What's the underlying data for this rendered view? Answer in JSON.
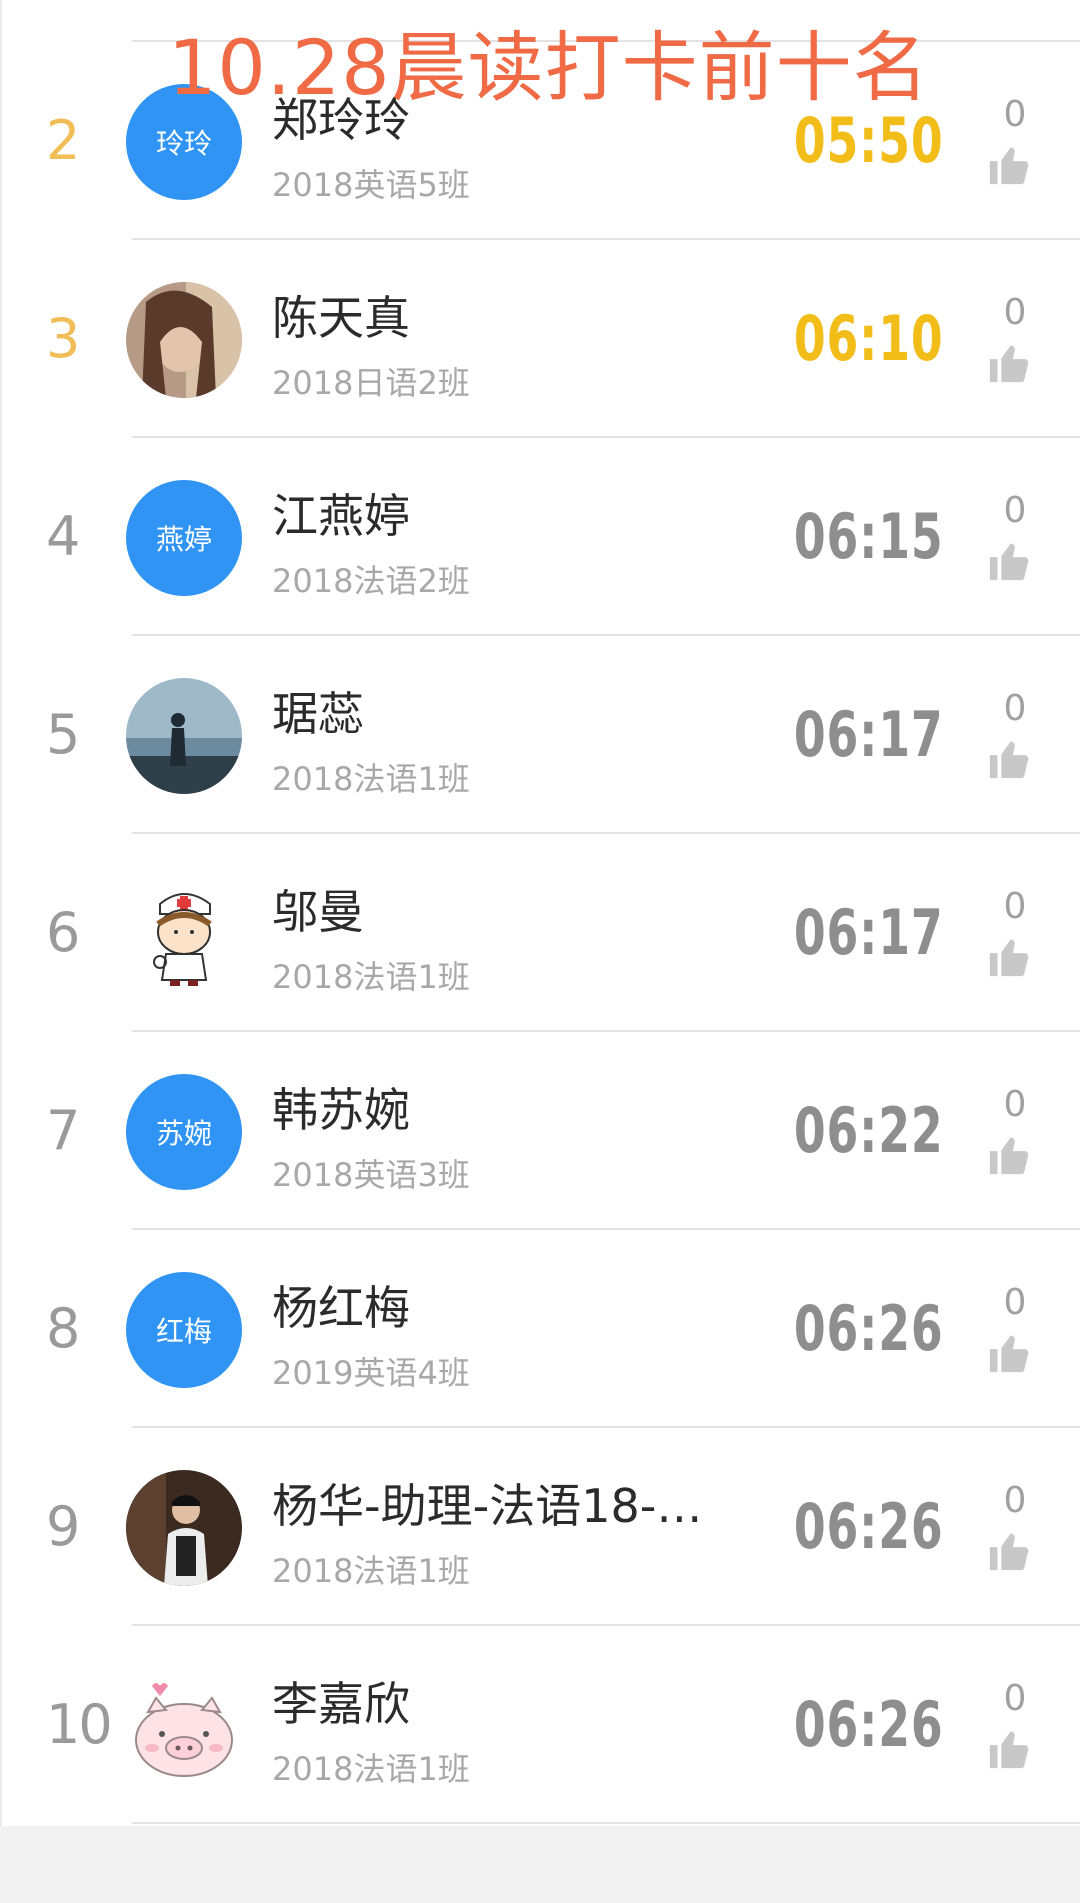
{
  "overlay_title": "10.28晨读打卡前十名",
  "colors": {
    "gold_rank": "#f1bd57",
    "gold_time": "#f3bd19",
    "avatar_blue": "#2f94f4",
    "title_orange": "#ef6a45",
    "grey_text": "#8e8e8e"
  },
  "entries": [
    {
      "rank": "2",
      "name": "郑玲玲",
      "class": "2018英语5班",
      "time": "05:50",
      "likes": "0",
      "avatar_text": "玲玲",
      "avatar_kind": "text",
      "highlight": true
    },
    {
      "rank": "3",
      "name": "陈天真",
      "class": "2018日语2班",
      "time": "06:10",
      "likes": "0",
      "avatar_text": "",
      "avatar_kind": "photo-girl-portrait",
      "highlight": true
    },
    {
      "rank": "4",
      "name": "江燕婷",
      "class": "2018法语2班",
      "time": "06:15",
      "likes": "0",
      "avatar_text": "燕婷",
      "avatar_kind": "text",
      "highlight": false
    },
    {
      "rank": "5",
      "name": "琚蕊",
      "class": "2018法语1班",
      "time": "06:17",
      "likes": "0",
      "avatar_text": "",
      "avatar_kind": "photo-silhouette-lake",
      "highlight": false
    },
    {
      "rank": "6",
      "name": "邬曼",
      "class": "2018法语1班",
      "time": "06:17",
      "likes": "0",
      "avatar_text": "",
      "avatar_kind": "cartoon-nurse",
      "highlight": false
    },
    {
      "rank": "7",
      "name": "韩苏婉",
      "class": "2018英语3班",
      "time": "06:22",
      "likes": "0",
      "avatar_text": "苏婉",
      "avatar_kind": "text",
      "highlight": false
    },
    {
      "rank": "8",
      "name": "杨红梅",
      "class": "2019英语4班",
      "time": "06:26",
      "likes": "0",
      "avatar_text": "红梅",
      "avatar_kind": "text",
      "highlight": false
    },
    {
      "rank": "9",
      "name": "杨华-助理-法语18-…",
      "class": "2018法语1班",
      "time": "06:26",
      "likes": "0",
      "avatar_text": "",
      "avatar_kind": "photo-man-indoor",
      "highlight": false
    },
    {
      "rank": "10",
      "name": "李嘉欣",
      "class": "2018法语1班",
      "time": "06:26",
      "likes": "0",
      "avatar_text": "",
      "avatar_kind": "cartoon-pig",
      "highlight": false
    }
  ]
}
